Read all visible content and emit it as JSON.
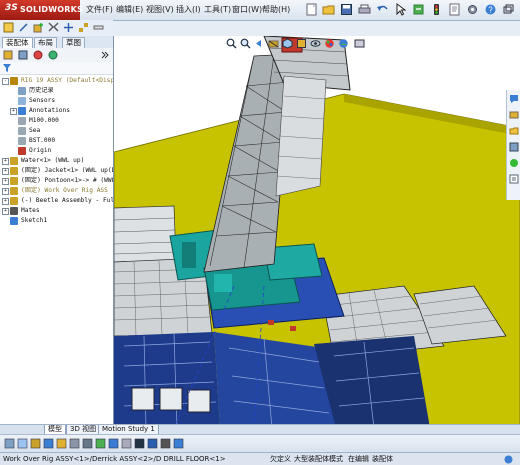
{
  "app": {
    "logo_ds": "3S",
    "logo_name": "SOLIDWORKS"
  },
  "menu": [
    "文件(F)",
    "编辑(E)",
    "视图(V)",
    "插入(I)",
    "工具(T)",
    "窗口(W)",
    "帮助(H)"
  ],
  "manager_tabs": [
    "装配体",
    "布局",
    "草图"
  ],
  "tree": [
    {
      "text": "RIG 19 ASSY (Default<Disp",
      "indent": 0,
      "exp": "-",
      "icon": "assembly-icon",
      "color": "#b8860b",
      "dim": true
    },
    {
      "text": "历史记录",
      "indent": 1,
      "exp": "",
      "icon": "history-icon",
      "color": "#7fa0c4"
    },
    {
      "text": "Sensors",
      "indent": 1,
      "exp": "",
      "icon": "sensor-icon",
      "color": "#8fb3da"
    },
    {
      "text": "Annotations",
      "indent": 1,
      "exp": "+",
      "icon": "annotation-icon",
      "color": "#3b7fd4"
    },
    {
      "text": "M100.000",
      "indent": 1,
      "exp": "",
      "icon": "plane-icon",
      "color": "#9aa7b5"
    },
    {
      "text": "Sea",
      "indent": 1,
      "exp": "",
      "icon": "plane-icon",
      "color": "#9aa7b5"
    },
    {
      "text": "BST.000",
      "indent": 1,
      "exp": "",
      "icon": "plane-icon",
      "color": "#9aa7b5"
    },
    {
      "text": "Origin",
      "indent": 1,
      "exp": "",
      "icon": "origin-icon",
      "color": "#c0392b"
    },
    {
      "text": "Water<1> (WWL up)",
      "indent": 0,
      "exp": "+",
      "icon": "part-icon",
      "color": "#c9a227"
    },
    {
      "text": "(固定) Jacket<1> (WWL up(Di",
      "indent": 0,
      "exp": "+",
      "icon": "assembly-icon",
      "color": "#c9a227"
    },
    {
      "text": "(固定) Pontoon<1>-> # (WWL",
      "indent": 0,
      "exp": "+",
      "icon": "assembly-icon",
      "color": "#c9a227"
    },
    {
      "text": "(固定) Work Over Rig ASS",
      "indent": 0,
      "exp": "+",
      "icon": "assembly-icon",
      "color": "#c9a227",
      "dim": true
    },
    {
      "text": "(-) Beetle Assembly - Full",
      "indent": 0,
      "exp": "+",
      "icon": "assembly-icon",
      "color": "#c9a227"
    },
    {
      "text": "Mates",
      "indent": 0,
      "exp": "+",
      "icon": "mates-icon",
      "color": "#555"
    },
    {
      "text": "Sketch1",
      "indent": 0,
      "exp": "",
      "icon": "sketch-icon",
      "color": "#3b7fd4"
    }
  ],
  "bottom_tabs": [
    "模型",
    "3D 视图",
    "Motion Study 1"
  ],
  "status": {
    "path": "Work Over Rig ASSY<1>/Derrick ASSY<2>/D DRILL FLOOR<1>",
    "item1": "欠定义",
    "item2": "大型装配体模式",
    "item3": "在编辑",
    "item4": "装配体"
  },
  "colors": {
    "deck_yellow": "#c9c400",
    "derrick_gray": "#9aa3a8",
    "machinery_teal": "#1aa5a0",
    "structure_blue": "#1e3a8a",
    "accent_red": "#c0392b"
  }
}
